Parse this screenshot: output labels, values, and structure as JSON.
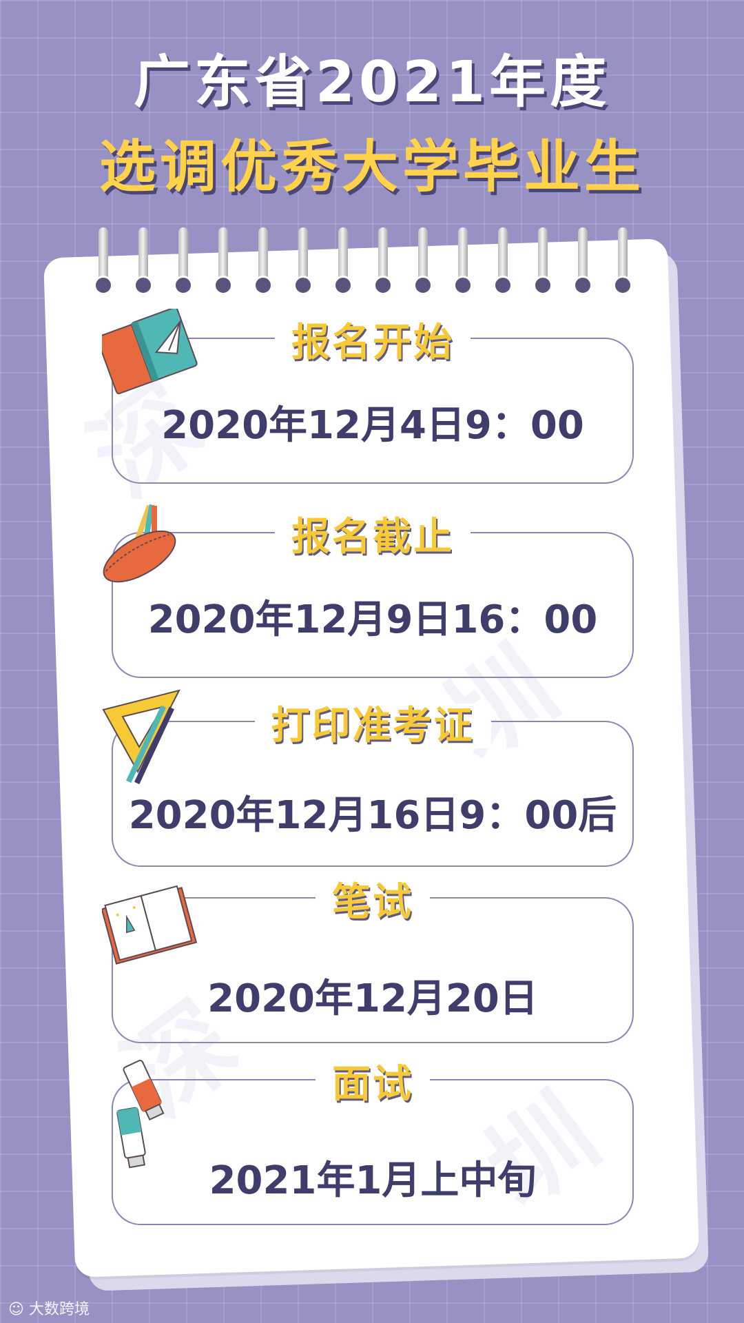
{
  "header": {
    "title_line1": "广东省2021年度",
    "title_line2": "选调优秀大学毕业生"
  },
  "events": [
    {
      "label": "报名开始",
      "date": "2020年12月4日9：00"
    },
    {
      "label": "报名截止",
      "date": "2020年12月9日16：00"
    },
    {
      "label": "打印准考证",
      "date": "2020年12月16日9：00后"
    },
    {
      "label": "笔试",
      "date": "2020年12月20日"
    },
    {
      "label": "面试",
      "date": "2021年1月上中旬"
    }
  ],
  "footer": {
    "logo_text": "大数跨境"
  },
  "colors": {
    "background": "#9791c4",
    "title_white": "#ffffff",
    "title_yellow": "#ffd24a",
    "label_yellow": "#f7c934",
    "date_text": "#3f3d6b",
    "card_border": "#8b86b8"
  },
  "icons": [
    "books-icon",
    "pencil-case-icon",
    "ruler-triangle-icon",
    "notebook-rocket-icon",
    "paint-tubes-icon"
  ]
}
